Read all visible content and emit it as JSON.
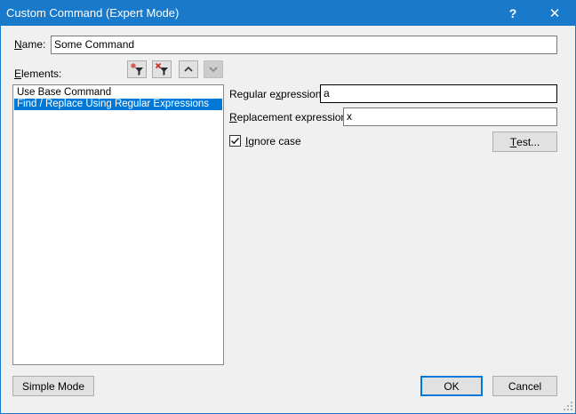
{
  "window": {
    "title": "Custom Command (Expert Mode)",
    "help_label": "?",
    "close_label": "✕"
  },
  "name": {
    "label_accel": "N",
    "label_rest": "ame:",
    "value": "Some Command"
  },
  "elements": {
    "label_accel": "E",
    "label_rest": "lements:",
    "toolbar": [
      {
        "icon": "add-filter-icon",
        "enabled": true
      },
      {
        "icon": "delete-filter-icon",
        "enabled": true
      },
      {
        "icon": "move-up-icon",
        "enabled": true
      },
      {
        "icon": "move-down-icon",
        "enabled": false
      }
    ],
    "items": [
      {
        "label": "Use Base Command",
        "selected": false
      },
      {
        "label": "Find / Replace Using Regular Expressions",
        "selected": true
      }
    ]
  },
  "regex": {
    "label_pre": "Regular e",
    "label_accel": "x",
    "label_post": "pression:",
    "value": "a"
  },
  "replacement": {
    "label_accel": "R",
    "label_rest": "eplacement expression:",
    "value": "x"
  },
  "ignore_case": {
    "label_accel": "I",
    "label_rest": "gnore case",
    "checked": true
  },
  "test_button": {
    "label_accel": "T",
    "label_rest": "est..."
  },
  "buttons": {
    "simple_mode": "Simple Mode",
    "ok": "OK",
    "cancel": "Cancel"
  },
  "colors": {
    "titlebar": "#1979ca",
    "selection": "#0078d7"
  }
}
